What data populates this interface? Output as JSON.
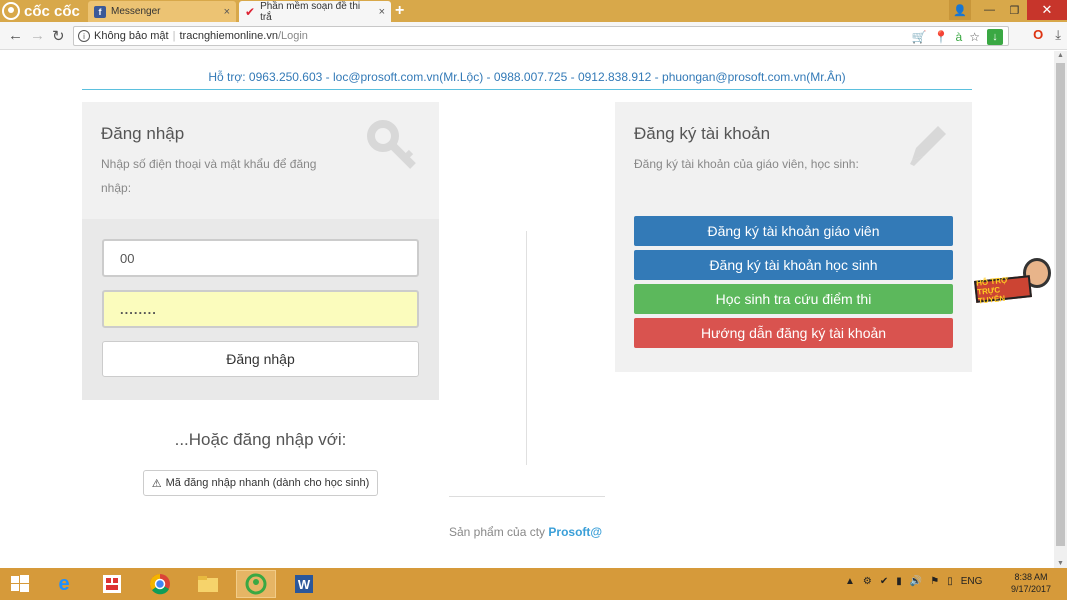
{
  "browser": {
    "brand": "cốc cốc",
    "tabs": [
      {
        "label": "Messenger",
        "close": "×"
      },
      {
        "label": "Phần mềm soạn đề thi trắ",
        "close": "×"
      }
    ],
    "new_tab": "+",
    "security": "Không bảo mật",
    "url_domain": "tracnghiemonline.vn",
    "url_path": "/Login"
  },
  "page": {
    "support": "Hỗ trợ: 0963.250.603 - loc@prosoft.com.vn(Mr.Lộc) - 0988.007.725 - 0912.838.912 - phuongan@prosoft.com.vn(Mr.Ân)",
    "login": {
      "title": "Đăng nhập",
      "desc": "Nhập số điện thoại và mật khẩu để đăng nhập:",
      "phone_value": "00",
      "password_value": "........",
      "button": "Đăng nhập"
    },
    "or_label": "...Hoặc đăng nhập với:",
    "quick_login": "Mã đăng nhập nhanh (dành cho học sinh)",
    "register": {
      "title": "Đăng ký tài khoản",
      "desc": "Đăng ký tài khoản của giáo viên, học sinh:",
      "buttons": [
        {
          "label": "Đăng ký tài khoản giáo viên",
          "color": "#337ab7"
        },
        {
          "label": "Đăng ký tài khoản học sinh",
          "color": "#337ab7"
        },
        {
          "label": "Học sinh tra cứu điểm thi",
          "color": "#5cb85c"
        },
        {
          "label": "Hướng dẫn đăng ký tài khoản",
          "color": "#d9534f"
        }
      ]
    },
    "footer_prefix": "Sản phẩm của cty",
    "footer_brand": "Prosoft@",
    "chat_label": "HỖ TRỢ TRỰC TUYẾN"
  },
  "taskbar": {
    "lang": "ENG",
    "time": "8:38 AM",
    "date": "9/17/2017"
  }
}
